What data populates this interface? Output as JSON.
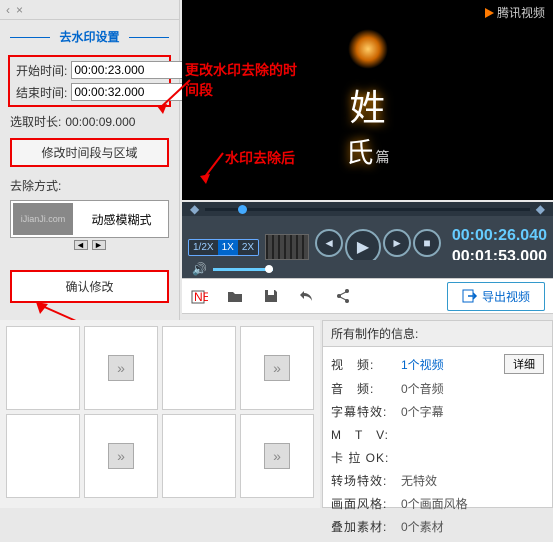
{
  "tab": {
    "close": "×",
    "arrow": "‹"
  },
  "section_title": "去水印设置",
  "fields": {
    "start_label": "开始时间:",
    "start_val": "00:00:23.000",
    "end_label": "结束时间:",
    "end_val": "00:00:32.000",
    "dur_label": "选取时长:",
    "dur_val": "00:00:09.000"
  },
  "edit_range_btn": "修改时间段与区域",
  "method_label": "去除方式:",
  "method": {
    "thumb_text": "iJianJi.com",
    "name": "动感模糊式"
  },
  "confirm_btn": "确认修改",
  "video": {
    "provider": "腾讯视频",
    "surname": "姓",
    "sub1": "氏",
    "sub2": "篇"
  },
  "annotations": {
    "a1": "更改水印去除的时\n间段",
    "a2": "水印去除后"
  },
  "speeds": {
    "half": "1/2X",
    "one": "1X",
    "two": "2X"
  },
  "time": {
    "current": "00:00:26.040",
    "total": "00:01:53.000"
  },
  "export_btn": "导出视频",
  "info": {
    "header": "所有制作的信息:",
    "rows": {
      "video": {
        "k": "视　频:",
        "v": "1个视频",
        "btn": "详细"
      },
      "audio": {
        "k": "音　频:",
        "v": "0个音频"
      },
      "subtitle": {
        "k": "字幕特效:",
        "v": "0个字幕"
      },
      "mtv": {
        "k": "M　T　V:",
        "v": ""
      },
      "karaoke": {
        "k": "卡 拉 OK:",
        "v": ""
      },
      "transition": {
        "k": "转场特效:",
        "v": "无特效"
      },
      "style": {
        "k": "画面风格:",
        "v": "0个画面风格"
      },
      "overlay": {
        "k": "叠加素材:",
        "v": "0个素材"
      }
    }
  }
}
